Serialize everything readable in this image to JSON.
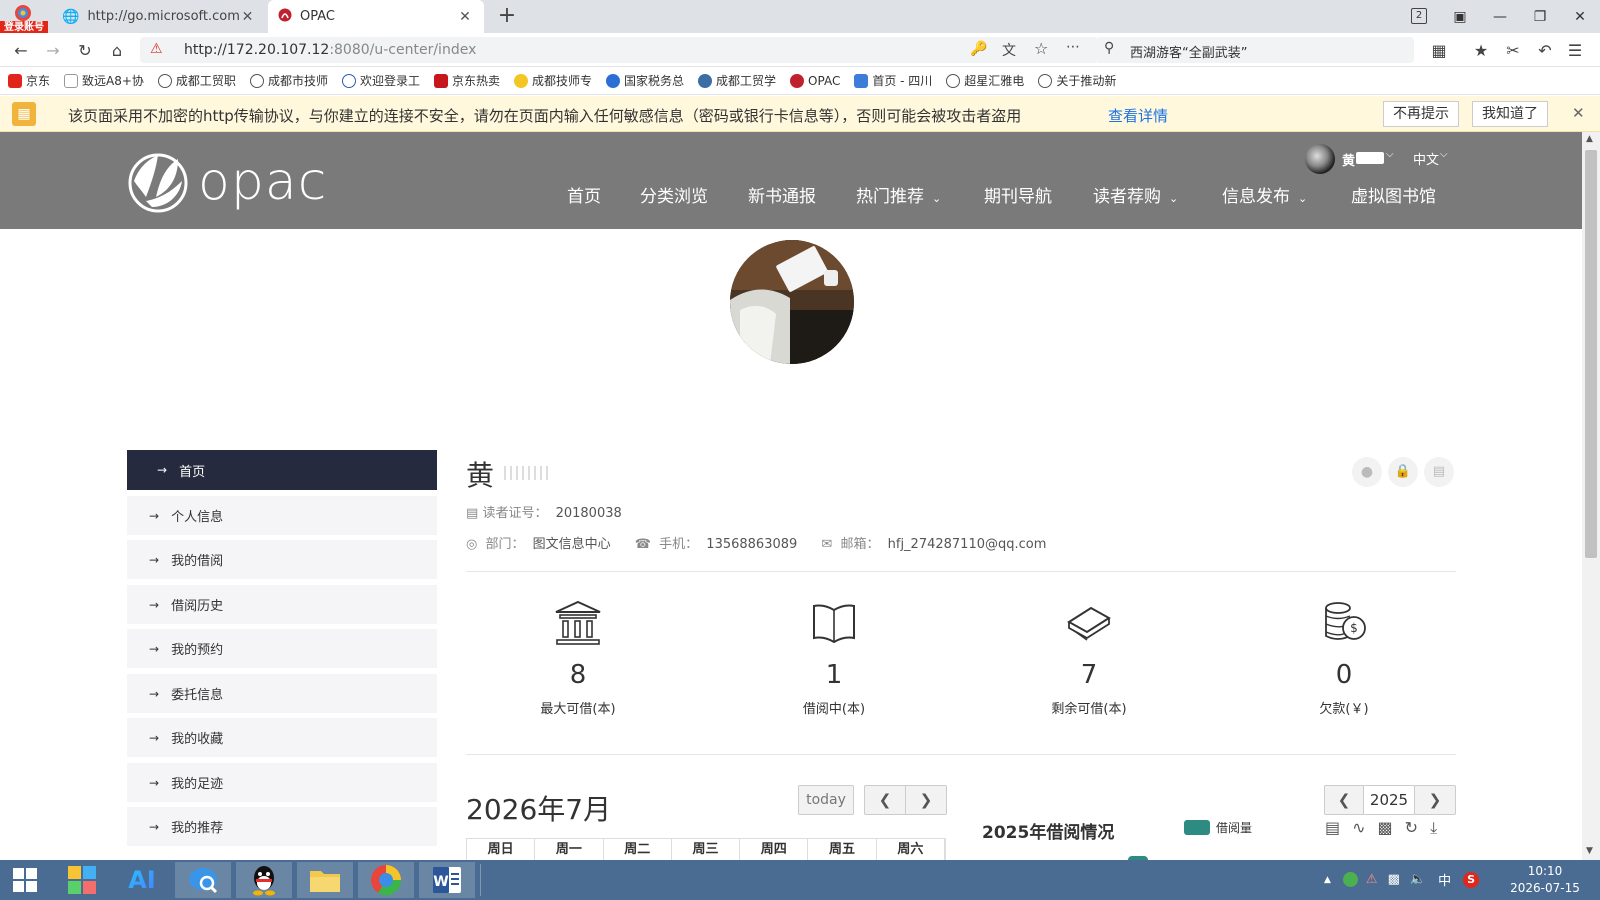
{
  "browser": {
    "login_badge": "登录账号",
    "tabs": [
      {
        "title": "http://go.microsoft.com/fw"
      },
      {
        "title": "OPAC"
      }
    ],
    "tab_count": "2",
    "url_host": "http://172.20.107.12",
    "url_rest": ":8080/u-center/index",
    "search_text": "西湖游客“全副武装”",
    "bookmarks": [
      "京东",
      "致远A8+协",
      "成都工贸职",
      "成都市技师",
      "欢迎登录工",
      "京东热卖",
      "成都技师专",
      "国家税务总",
      "成都工贸学",
      "OPAC",
      "首页 - 四川",
      "超星汇雅电",
      "关于推动新"
    ]
  },
  "warning": {
    "text": "该页面采用不加密的http传输协议，与你建立的连接不安全，请勿在页面内输入任何敏感信息（密码或银行卡信息等），否则可能会被攻击者盗用",
    "link": "查看详情",
    "btn_dismiss": "不再提示",
    "btn_ok": "我知道了"
  },
  "site": {
    "logo_text": "opac",
    "user_name": "黄",
    "language": "中文",
    "menu": [
      {
        "label": "首页",
        "dropdown": false
      },
      {
        "label": "分类浏览",
        "dropdown": false
      },
      {
        "label": "新书通报",
        "dropdown": false
      },
      {
        "label": "热门推荐",
        "dropdown": true
      },
      {
        "label": "期刊导航",
        "dropdown": false
      },
      {
        "label": "读者荐购",
        "dropdown": true
      },
      {
        "label": "信息发布",
        "dropdown": true
      },
      {
        "label": "虚拟图书馆",
        "dropdown": false
      }
    ]
  },
  "sidebar": {
    "items": [
      "首页",
      "个人信息",
      "我的借阅",
      "借阅历史",
      "我的预约",
      "委托信息",
      "我的收藏",
      "我的足迹",
      "我的推荐"
    ],
    "active_index": 0
  },
  "profile": {
    "name": "黄",
    "reader_label": "读者证号：",
    "reader_no": "20180038",
    "dept_label": "部门：",
    "dept": "图文信息中心",
    "phone_label": "手机：",
    "phone": "13568863089",
    "email_label": "邮箱：",
    "email": "hfj_274287110@qq.com"
  },
  "stats": [
    {
      "value": "8",
      "label": "最大可借(本)",
      "icon": "library-icon"
    },
    {
      "value": "1",
      "label": "借阅中(本)",
      "icon": "book-open-icon"
    },
    {
      "value": "7",
      "label": "剩余可借(本)",
      "icon": "books-stack-icon"
    },
    {
      "value": "0",
      "label": "欠款(￥)",
      "icon": "coins-icon"
    }
  ],
  "calendar": {
    "title": "2026年7月",
    "today_label": "today",
    "weekdays": [
      "周日",
      "周一",
      "周二",
      "周三",
      "周四",
      "周五",
      "周六"
    ]
  },
  "chart": {
    "year": "2025",
    "title": "2025年借阅情况",
    "legend": "借阅量",
    "series_color": "#2e8b82"
  },
  "taskbar": {
    "time": "10:10",
    "date": "2026-07-15",
    "ime": "中"
  }
}
